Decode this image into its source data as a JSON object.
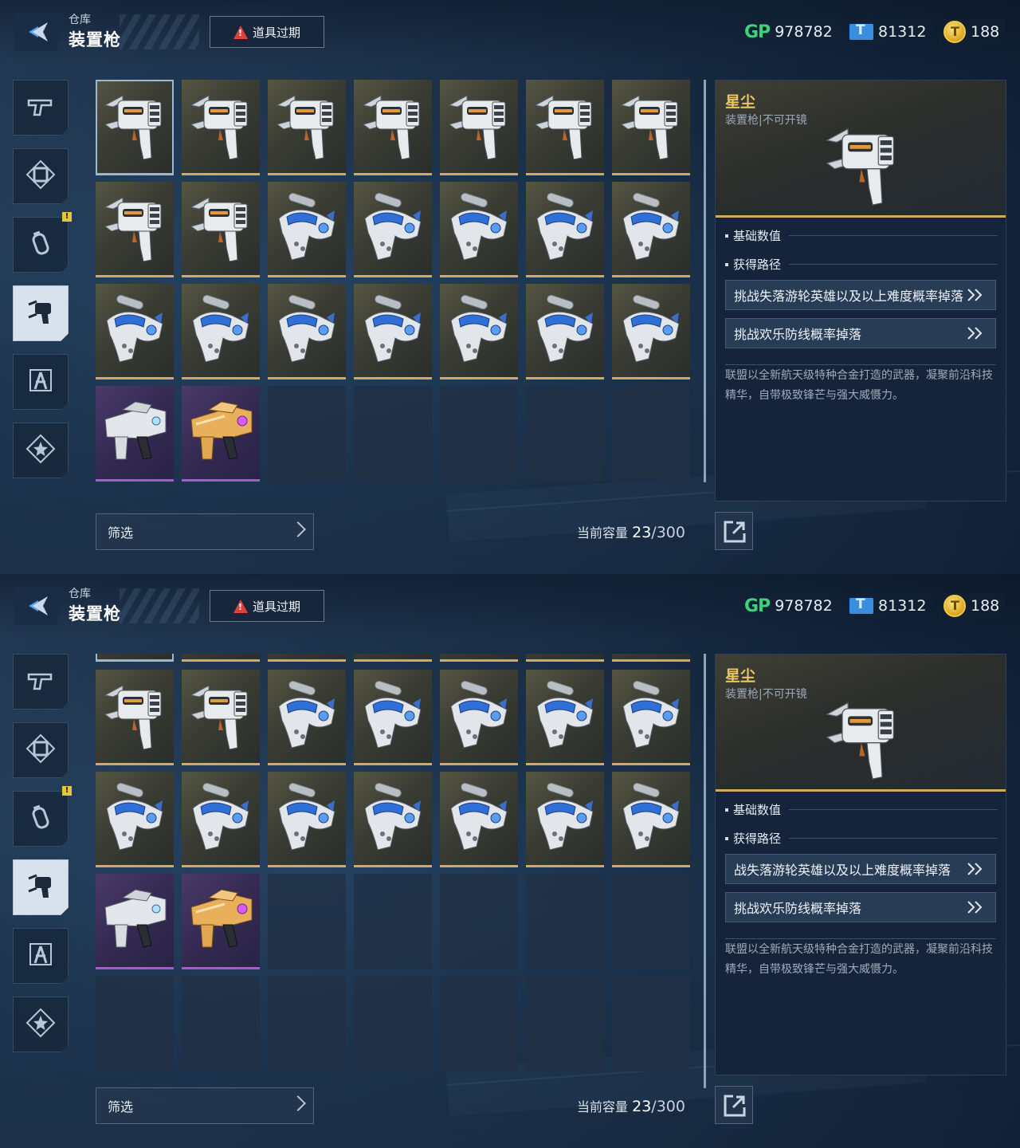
{
  "header": {
    "breadcrumb": "仓库",
    "title": "装置枪",
    "expire_button": "道具过期"
  },
  "currencies": {
    "gp": {
      "label": "GP",
      "value": "978782"
    },
    "ticket": {
      "value": "81312"
    },
    "coin": {
      "value": "188"
    }
  },
  "side_tabs": [
    {
      "icon": "pistol-icon"
    },
    {
      "icon": "frame-icon"
    },
    {
      "icon": "grenade-icon",
      "badge": "!"
    },
    {
      "icon": "device-gun-icon",
      "active": true
    },
    {
      "icon": "character-icon"
    },
    {
      "icon": "star-badge-icon"
    }
  ],
  "detail": {
    "name": "星尘",
    "subtitle": "装置枪|不可开镜",
    "section_base": "基础数值",
    "section_source": "获得路径"
  },
  "screens": [
    {
      "path_button_1": "挑战失落游轮英雄以及以上难度概率掉落",
      "path_button_2": "挑战欢乐防线概率掉落",
      "description": "联盟以全新航天级特种合金打造的武器，凝聚前沿科技精华，自带极致锋芒与强大威慑力。"
    },
    {
      "path_button_1": "战失落游轮英雄以及以上难度概率掉落",
      "path_button_2": "挑战欢乐防线概率掉落",
      "description": "联盟以全新航天级特种合金打造的武器，凝聚前沿科技精华，自带极致锋芒与强大威慑力。"
    }
  ],
  "footer": {
    "filter_label": "筛选",
    "capacity_label": "当前容量",
    "capacity_current": "23",
    "capacity_total": "/300"
  },
  "inventory": {
    "items": [
      "claw-gun",
      "claw-gun",
      "claw-gun",
      "claw-gun",
      "claw-gun",
      "claw-gun",
      "claw-gun",
      "claw-gun",
      "claw-gun",
      "blue-gun",
      "blue-gun",
      "blue-gun",
      "blue-gun",
      "blue-gun",
      "blue-gun",
      "blue-gun",
      "blue-gun",
      "blue-gun",
      "blue-gun",
      "blue-gun",
      "blue-gun",
      "white-pistol",
      "gold-pistol"
    ],
    "total_slots": 28
  },
  "colors": {
    "gold_rarity": "#d1aa5e",
    "purple_rarity": "#a25cd2",
    "accent_title": "#ecc462"
  }
}
